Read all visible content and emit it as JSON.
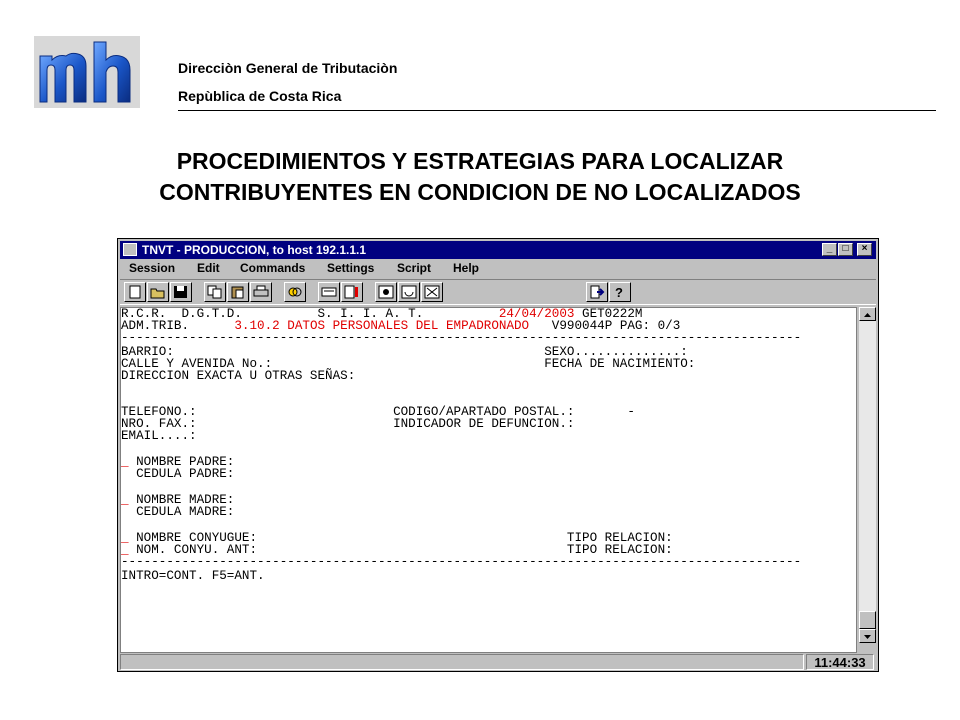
{
  "header": {
    "org_line1": "Direcciòn General de Tributaciòn",
    "org_line2": "Repùblica de Costa Rica",
    "logo_text": "mh",
    "title_line1": "PROCEDIMIENTOS Y ESTRATEGIAS PARA LOCALIZAR",
    "title_line2": "CONTRIBUYENTES EN CONDICION DE NO LOCALIZADOS"
  },
  "window": {
    "title": "TNVT - PRODUCCION, to host 192.1.1.1",
    "controls": {
      "minimize": "_",
      "maximize": "□",
      "close": "×"
    },
    "menu": [
      "Session",
      "Edit",
      "Commands",
      "Settings",
      "Script",
      "Help"
    ],
    "toolbar_icons": [
      "new-icon",
      "open-icon",
      "save-icon",
      "copy-icon",
      "paste-icon",
      "print-icon",
      "connect-icon",
      "keyboard-icon",
      "keymap-icon",
      "macro-icon",
      "record-icon",
      "disconnect-icon",
      "exit-icon",
      "help-icon"
    ],
    "help_glyph": "?",
    "clock": "11:44:33"
  },
  "terminal": {
    "l1_left": "R.C.R.  D.G.T.D.          S. I. I. A. T.          ",
    "l1_date": "24/04/2003",
    "l1_right": " GET0222M",
    "l2_left": "ADM.TRIB.      ",
    "l2_title": "3.10.2 DATOS PERSONALES DEL EMPADRONADO",
    "l2_right": "   V990044P PAG: 0/3",
    "sep": "------------------------------------------------------------------------------------------",
    "l4": "BARRIO:                                                 SEXO..............:",
    "l5": "CALLE Y AVENIDA No.:                                    FECHA DE NACIMIENTO:",
    "l6": "DIRECCION EXACTA U OTRAS SEÑAS:",
    "l10": "TELEFONO.:                          CODIGO/APARTADO POSTAL.:       -",
    "l11": "NRO. FAX.:                          INDICADOR DE DEFUNCION.:",
    "l12": "EMAIL....:",
    "cursor": "_",
    "l14": " NOMBRE PADRE:",
    "l15": "  CEDULA PADRE:",
    "l17": " NOMBRE MADRE:",
    "l18": "  CEDULA MADRE:",
    "l20": " NOMBRE CONYUGUE:                                         TIPO RELACION:",
    "l21": " NOM. CONYU. ANT:                                         TIPO RELACION:",
    "l23": "INTRO=CONT. F5=ANT."
  },
  "colors": {
    "titlebar": "#000080",
    "accent_red": "#e00000",
    "logo_blue": "#1a56c8"
  }
}
